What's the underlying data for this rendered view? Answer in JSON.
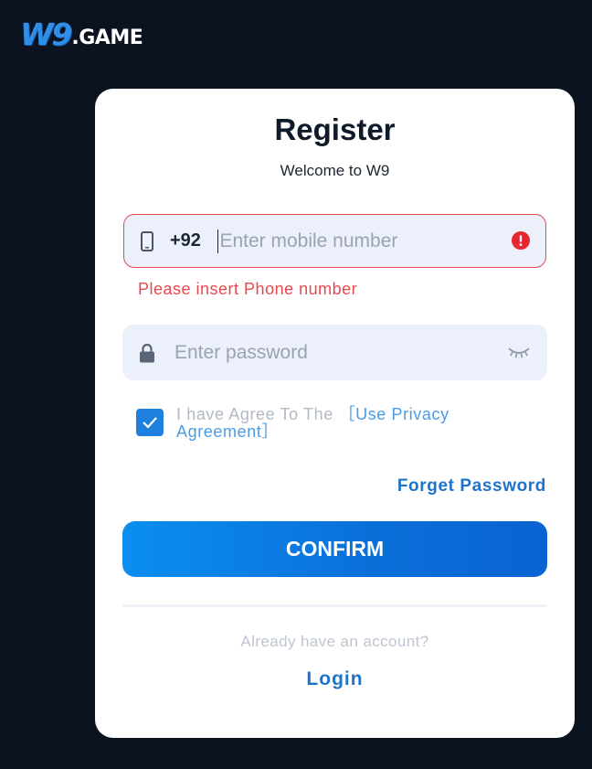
{
  "logo": {
    "brand": "W9",
    "suffix": ".GAME"
  },
  "form": {
    "title": "Register",
    "subtitle": "Welcome to W9",
    "phone": {
      "country_code": "+92",
      "placeholder": "Enter mobile number",
      "value": "",
      "icon": "phone-icon",
      "status_icon": "alert-icon",
      "error": "Please insert Phone number"
    },
    "password": {
      "placeholder": "Enter password",
      "value": "",
      "icon": "lock-icon",
      "toggle_icon": "eye-closed-icon"
    },
    "agreement": {
      "checked": true,
      "text": "I have Agree To The ",
      "link": "［Use Privacy Agreement］"
    },
    "forget_password": "Forget Password",
    "confirm": "CONFIRM",
    "already": "Already have an account?",
    "login": "Login"
  },
  "colors": {
    "background": "#0b1220",
    "accent": "#1f74c9",
    "error": "#e8484f",
    "field_bg": "#ecf0fa"
  }
}
